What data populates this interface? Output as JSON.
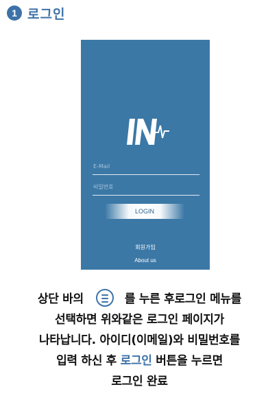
{
  "step": {
    "number": "1",
    "title": "로그인"
  },
  "app": {
    "email_placeholder": "E-Mail",
    "password_placeholder": "비밀번호",
    "login_label": "LOGIN",
    "signup_label": "회원가입",
    "about_label": "About us"
  },
  "instructions": {
    "line1_before": "상단 바의",
    "line1_after": "를 누른 후로그인 메뉴를",
    "line2": "선택하면 위와같은 로그인 페이지가",
    "line3": "나타납니다. 아이디(이메일)와 비밀번호를",
    "line4_before": "입력 하신 후 ",
    "line4_accent": "로그인",
    "line4_after": " 버튼을 누르면",
    "line5": "로그인 완료"
  },
  "colors": {
    "accent": "#3d72a8",
    "phone_bg": "#3b78a6"
  },
  "icons": {
    "menu": "hamburger-menu-icon",
    "logo": "app-logo-pulse-icon"
  }
}
